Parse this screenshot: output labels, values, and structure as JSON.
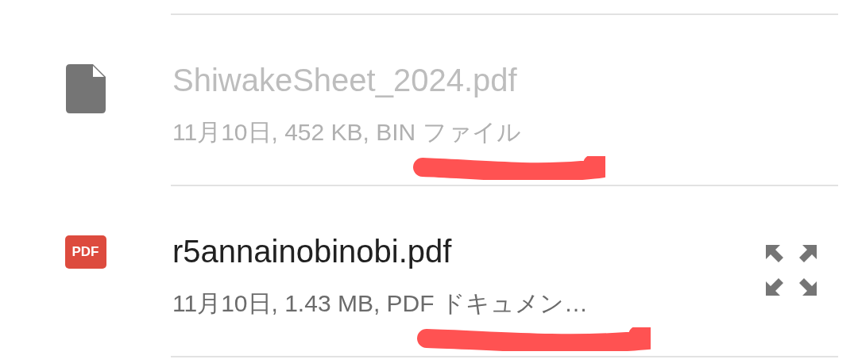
{
  "files": [
    {
      "name": "ShiwakeSheet_2024.pdf",
      "details": "11月10日, 452 KB, BIN ファイル",
      "kind": "generic",
      "disabled": true,
      "expandable": false,
      "underlined": true
    },
    {
      "name": "r5annainobinobi.pdf",
      "details": "11月10日, 1.43 MB, PDF ドキュメン…",
      "kind": "pdf",
      "icon_label": "PDF",
      "disabled": false,
      "expandable": true,
      "underlined": true
    }
  ]
}
